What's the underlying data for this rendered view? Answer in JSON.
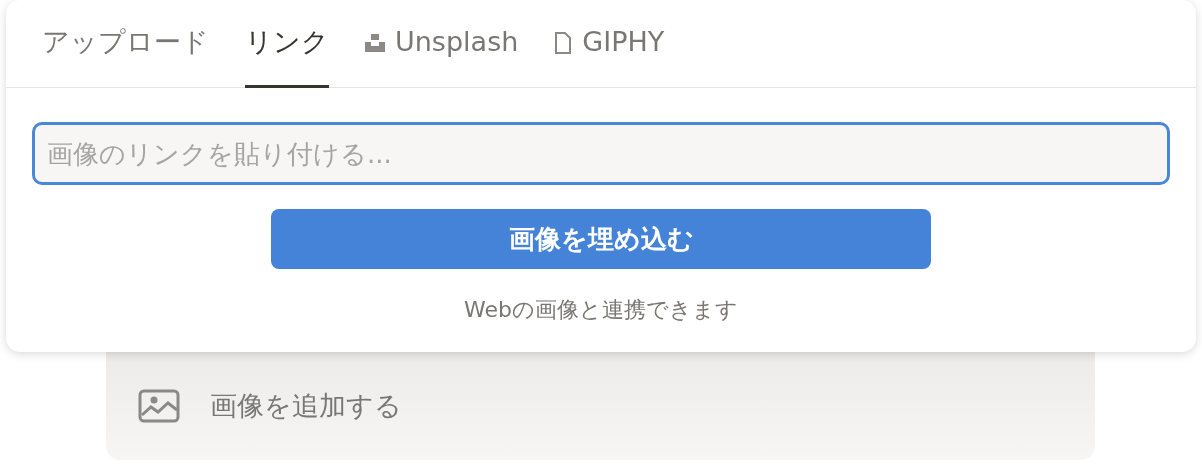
{
  "tabs": [
    {
      "label": "アップロード",
      "kind": "plain",
      "selected": false
    },
    {
      "label": "リンク",
      "kind": "plain",
      "selected": true
    },
    {
      "label": "Unsplash",
      "kind": "unsplash",
      "selected": false
    },
    {
      "label": "GIPHY",
      "kind": "file",
      "selected": false
    }
  ],
  "link_field": {
    "placeholder": "画像のリンクを貼り付ける...",
    "focused": true
  },
  "embed_button": "画像を埋め込む",
  "note": "Webの画像と連携できます",
  "add_image": {
    "label": "画像を追加する"
  }
}
